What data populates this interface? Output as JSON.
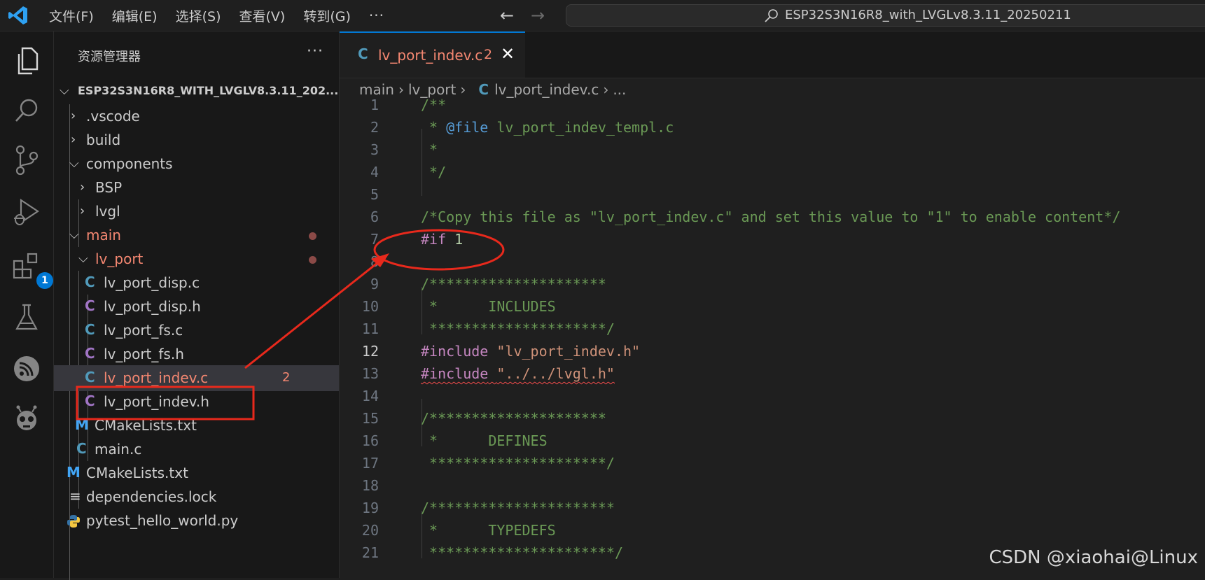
{
  "window": {
    "title": "ESP32S3N16R8_with_LVGLv8.3.11_20250211"
  },
  "menu": [
    "文件(F)",
    "编辑(E)",
    "选择(S)",
    "查看(V)",
    "转到(G)",
    "···"
  ],
  "activity": {
    "extensions_badge": "1"
  },
  "explorer": {
    "title": "资源管理器",
    "more": "···",
    "root": "ESP32S3N16R8_WITH_LVGLV8.3.11_202...",
    "items": [
      {
        "label": ".vscode"
      },
      {
        "label": "build"
      },
      {
        "label": "components"
      },
      {
        "label": "BSP"
      },
      {
        "label": "lvgl"
      },
      {
        "label": "main"
      },
      {
        "label": "lv_port"
      },
      {
        "label": "lv_port_disp.c",
        "icon": "C"
      },
      {
        "label": "lv_port_disp.h",
        "icon": "C"
      },
      {
        "label": "lv_port_fs.c",
        "icon": "C"
      },
      {
        "label": "lv_port_fs.h",
        "icon": "C"
      },
      {
        "label": "lv_port_indev.c",
        "icon": "C",
        "problems": "2"
      },
      {
        "label": "lv_port_indev.h",
        "icon": "C"
      },
      {
        "label": "CMakeLists.txt",
        "icon": "M"
      },
      {
        "label": "main.c",
        "icon": "C"
      },
      {
        "label": "CMakeLists.txt",
        "icon": "M"
      },
      {
        "label": "dependencies.lock",
        "icon": "≡"
      },
      {
        "label": "pytest_hello_world.py"
      }
    ]
  },
  "tab": {
    "icon": "C",
    "name": "lv_port_indev.c",
    "problems": "2",
    "close": "✕"
  },
  "breadcrumb": [
    "main",
    "lv_port",
    "C",
    "lv_port_indev.c",
    "..."
  ],
  "code": {
    "lines": [
      "1",
      "2",
      "3",
      "4",
      "5",
      "6",
      "7",
      "8",
      "9",
      "10",
      "11",
      "12",
      "13",
      "14",
      "15",
      "16",
      "17",
      "18",
      "19",
      "20",
      "21"
    ],
    "l1": "/**",
    "l2a": " * ",
    "l2b": "@file",
    "l2c": " lv_port_indev_templ.c",
    "l3": " *",
    "l4": " */",
    "l6": "/*Copy this file as \"lv_port_indev.c\" and set this value to \"1\" to enable content*/",
    "l7a": "#if",
    "l7b": "1",
    "l9": "/*********************",
    "l10": " *      INCLUDES",
    "l11": " *********************/",
    "l12a": "#include",
    "l12b": "\"lv_port_indev.h\"",
    "l13a": "#include",
    "l13b": "\"../../lvgl.h\"",
    "l15": "/*********************",
    "l16": " *      DEFINES",
    "l17": " *********************/",
    "l19": "/**********************",
    "l20": " *      TYPEDEFS",
    "l21": " **********************/"
  },
  "watermark": "CSDN @xiaohai@Linux",
  "colors": {
    "accent": "#0078d4",
    "error": "#f48771",
    "annotation": "#e8291c"
  }
}
